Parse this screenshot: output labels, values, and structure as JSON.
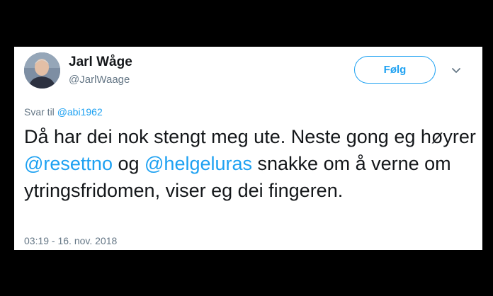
{
  "user": {
    "name": "Jarl Wåge",
    "handle": "@JarlWaage"
  },
  "actions": {
    "follow_label": "Følg",
    "menu_icon": "chevron-down-icon"
  },
  "reply": {
    "prefix": "Svar til",
    "mention": "@abi1962"
  },
  "tweet": {
    "seg1": "Då har dei nok stengt meg ute. Neste gong eg høyrer ",
    "mention1": "@resettno",
    "seg2": " og ",
    "mention2": "@helgeluras",
    "seg3": " snakke om å verne om ytringsfridomen, viser eg dei fingeren."
  },
  "meta": {
    "timestamp": "03:19 - 16. nov. 2018"
  },
  "colors": {
    "accent": "#1da1f2",
    "text": "#14171a",
    "muted": "#657786",
    "frame": "#000000"
  }
}
